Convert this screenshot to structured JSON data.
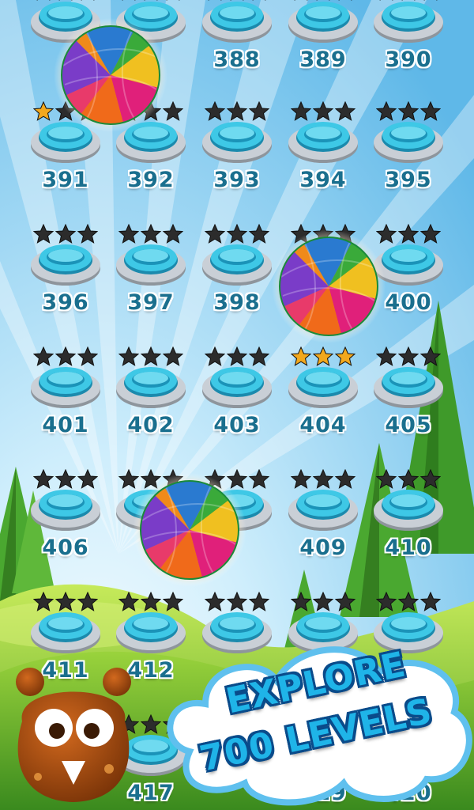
{
  "levels": [
    {
      "number": "",
      "stars": 0,
      "ball": false
    },
    {
      "number": "",
      "stars": 0,
      "ball": false
    },
    {
      "number": "388",
      "stars": 0,
      "ball": false
    },
    {
      "number": "389",
      "stars": 0,
      "ball": false
    },
    {
      "number": "390",
      "stars": 0,
      "ball": false
    },
    {
      "number": "391",
      "stars": 1,
      "ball": false
    },
    {
      "number": "392",
      "stars": 0,
      "ball": false
    },
    {
      "number": "393",
      "stars": 0,
      "ball": false
    },
    {
      "number": "394",
      "stars": 0,
      "ball": false
    },
    {
      "number": "395",
      "stars": 0,
      "ball": false
    },
    {
      "number": "396",
      "stars": 0,
      "ball": false
    },
    {
      "number": "397",
      "stars": 0,
      "ball": false
    },
    {
      "number": "398",
      "stars": 0,
      "ball": false
    },
    {
      "number": "",
      "stars": 0,
      "ball": false
    },
    {
      "number": "400",
      "stars": 0,
      "ball": false
    },
    {
      "number": "401",
      "stars": 0,
      "ball": false
    },
    {
      "number": "402",
      "stars": 0,
      "ball": false
    },
    {
      "number": "403",
      "stars": 0,
      "ball": false
    },
    {
      "number": "404",
      "stars": 3,
      "ball": false
    },
    {
      "number": "405",
      "stars": 0,
      "ball": false
    },
    {
      "number": "406",
      "stars": 0,
      "ball": false
    },
    {
      "number": "",
      "stars": 0,
      "ball": false
    },
    {
      "number": "",
      "stars": 0,
      "ball": false
    },
    {
      "number": "409",
      "stars": 0,
      "ball": false
    },
    {
      "number": "410",
      "stars": 0,
      "ball": false
    },
    {
      "number": "411",
      "stars": 0,
      "ball": false
    },
    {
      "number": "412",
      "stars": 0,
      "ball": false
    },
    {
      "number": "",
      "stars": 0,
      "ball": false
    },
    {
      "number": "",
      "stars": 0,
      "ball": false
    },
    {
      "number": "",
      "stars": 0,
      "ball": false
    },
    {
      "number": "",
      "stars": 0,
      "ball": false
    },
    {
      "number": "417",
      "stars": 0,
      "ball": false
    },
    {
      "number": "",
      "stars": 0,
      "ball": false
    },
    {
      "number": "419",
      "stars": 0,
      "ball": false
    },
    {
      "number": "420",
      "stars": 0,
      "ball": false
    }
  ],
  "promo": {
    "line1": "EXPLORE",
    "line2": "700 LEVELS"
  },
  "colors": {
    "button_cyan": "#3ec8e6",
    "button_silver": "#c9cfd6",
    "star_dark": "#2c2c2c",
    "star_gold": "#f2a81d",
    "number_blue": "#1a6f8e",
    "promo_text": "#1fb4e8",
    "promo_outline": "#0a4b8a",
    "tree_green": "#3f9a2a"
  },
  "icons": [
    "level-button-icon",
    "star-icon",
    "yarn-ball-icon",
    "mascot-icon",
    "cloud-icon"
  ]
}
